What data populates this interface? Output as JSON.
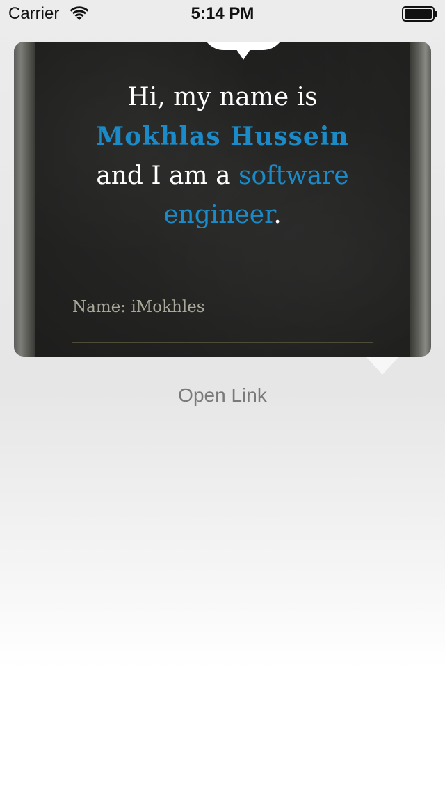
{
  "status_bar": {
    "carrier": "Carrier",
    "time": "5:14 PM",
    "wifi_icon": "wifi-icon",
    "battery_icon": "battery-icon"
  },
  "card": {
    "intro_line1": "Hi, my name is",
    "intro_name": "Mokhlas Hussein",
    "intro_line3_prefix": "and I am a ",
    "intro_role_part1": "software",
    "intro_role_part2": "engineer",
    "intro_period": ".",
    "field_label": "Name: iMokhles",
    "accent_color": "#1a8bc8"
  },
  "actions": {
    "open_link": "Open Link"
  }
}
